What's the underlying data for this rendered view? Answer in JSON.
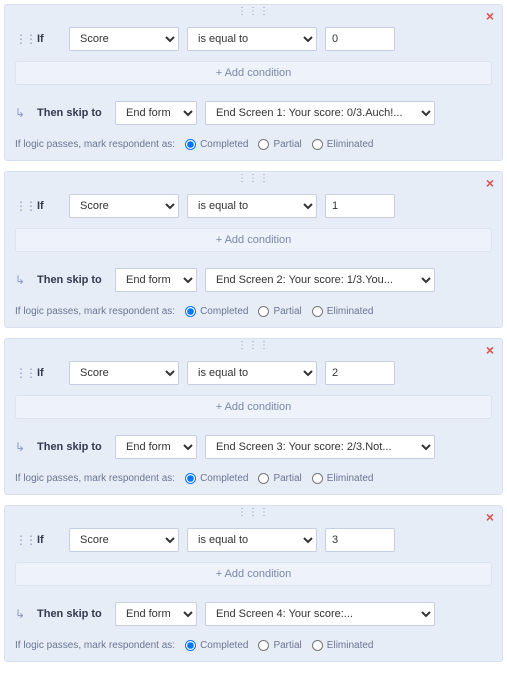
{
  "labels": {
    "if": "If",
    "then_skip_to": "Then skip to",
    "add_condition": "+ Add condition",
    "mark_respondent": "If logic passes, mark respondent as:",
    "completed": "Completed",
    "partial": "Partial",
    "eliminated": "Eliminated"
  },
  "rules": [
    {
      "field": "Score",
      "operator": "is equal to",
      "value": "0",
      "skip_target": "End form",
      "screen": "End Screen 1: Your score: 0/3.Auch!...",
      "respondent_status": "Completed"
    },
    {
      "field": "Score",
      "operator": "is equal to",
      "value": "1",
      "skip_target": "End form",
      "screen": "End Screen 2: Your score: 1/3.You...",
      "respondent_status": "Completed"
    },
    {
      "field": "Score",
      "operator": "is equal to",
      "value": "2",
      "skip_target": "End form",
      "screen": "End Screen 3: Your score: 2/3.Not...",
      "respondent_status": "Completed"
    },
    {
      "field": "Score",
      "operator": "is equal to",
      "value": "3",
      "skip_target": "End form",
      "screen": "End Screen 4: Your score:...",
      "respondent_status": "Completed"
    }
  ]
}
